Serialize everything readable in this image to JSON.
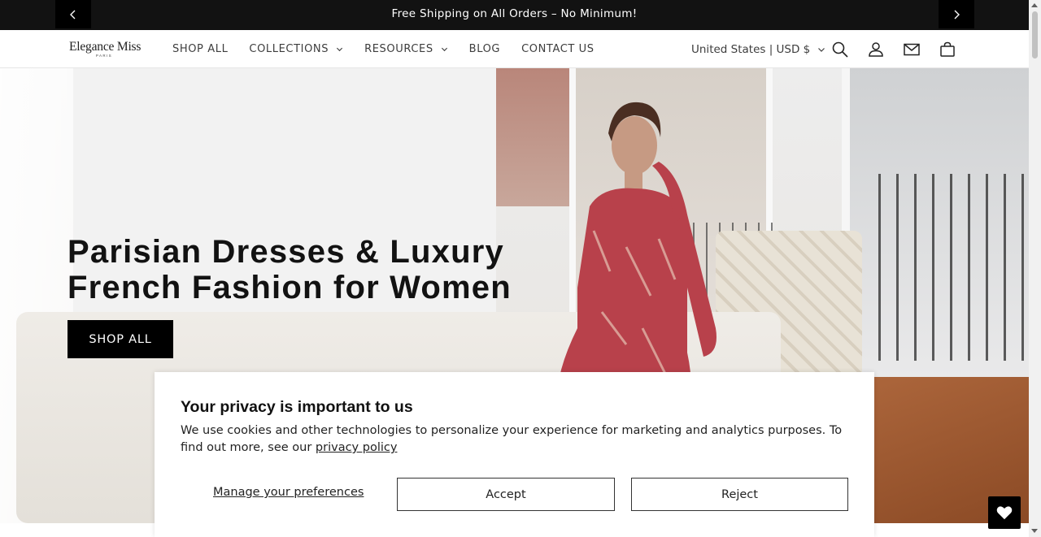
{
  "announcement": {
    "message": "Free Shipping on All Orders – No Minimum!",
    "prev_icon": "chevron-left-icon",
    "next_icon": "chevron-right-icon"
  },
  "header": {
    "logo_main": "Elegance Miss",
    "logo_sub": "PARIS",
    "nav": [
      {
        "label": "SHOP ALL",
        "has_dropdown": false
      },
      {
        "label": "COLLECTIONS",
        "has_dropdown": true
      },
      {
        "label": "RESOURCES",
        "has_dropdown": true
      },
      {
        "label": "BLOG",
        "has_dropdown": false
      },
      {
        "label": "CONTACT US",
        "has_dropdown": false
      }
    ],
    "region": "United States | USD $",
    "icons": [
      "search-icon",
      "account-icon",
      "mail-icon",
      "cart-icon"
    ]
  },
  "hero": {
    "heading_line1": "Parisian Dresses & Luxury",
    "heading_line2": "French Fashion for Women",
    "cta_label": "SHOP ALL"
  },
  "cookie": {
    "title": "Your privacy is important to us",
    "body": "We use cookies and other technologies to personalize your experience for marketing and analytics purposes. To find out more, see our",
    "link_text": "privacy policy",
    "manage_label": "Manage your preferences",
    "accept_label": "Accept",
    "reject_label": "Reject"
  },
  "colors": {
    "announcement_bg": "#121212",
    "cta_bg": "#000000",
    "text": "#121212"
  }
}
